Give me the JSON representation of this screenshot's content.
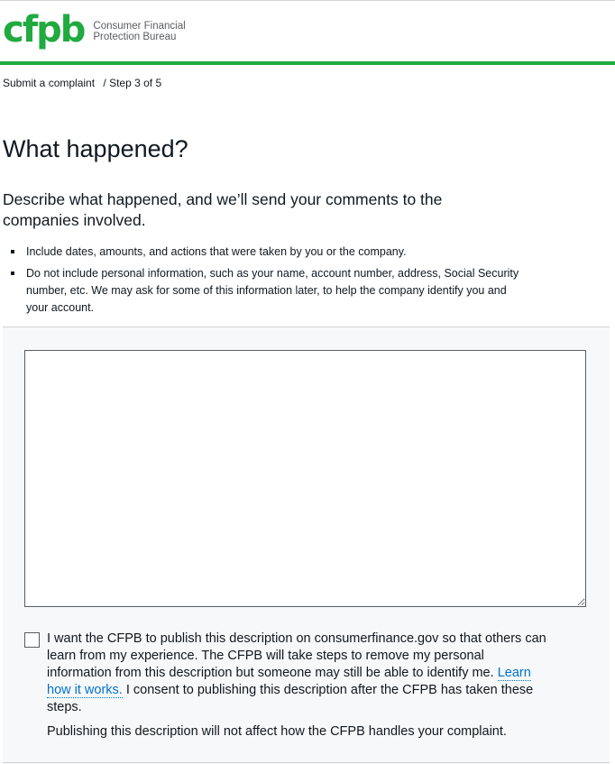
{
  "header": {
    "logo_mark": "cfpb",
    "logo_line1": "Consumer Financial",
    "logo_line2": "Protection Bureau",
    "brand_color": "#20aa3f"
  },
  "breadcrumb": {
    "link": "Submit a complaint",
    "separator": "/",
    "step": "Step 3 of 5"
  },
  "page": {
    "title": "What happened?",
    "lead": "Describe what happened, and we’ll send your comments to the companies involved.",
    "bullets": [
      "Include dates, amounts, and actions that were taken by you or the company.",
      "Do not include personal information, such as your name, account number, address, Social Security number, etc. We may ask for some of this information later, to help the company identify you and your account."
    ]
  },
  "form": {
    "description_value": "",
    "publish_checked": false,
    "consent_text_before": "I want the CFPB to publish this description on consumerfinance.gov so that others can learn from my experience. The CFPB will take steps to remove my personal information from this description but someone may still be able to identify me. ",
    "consent_link": "Learn how it works.",
    "consent_text_after": " I consent to publishing this description after the CFPB has taken these steps.",
    "consent_note": "Publishing this description will not affect how the CFPB handles your complaint.",
    "link_color": "#0072ce"
  }
}
